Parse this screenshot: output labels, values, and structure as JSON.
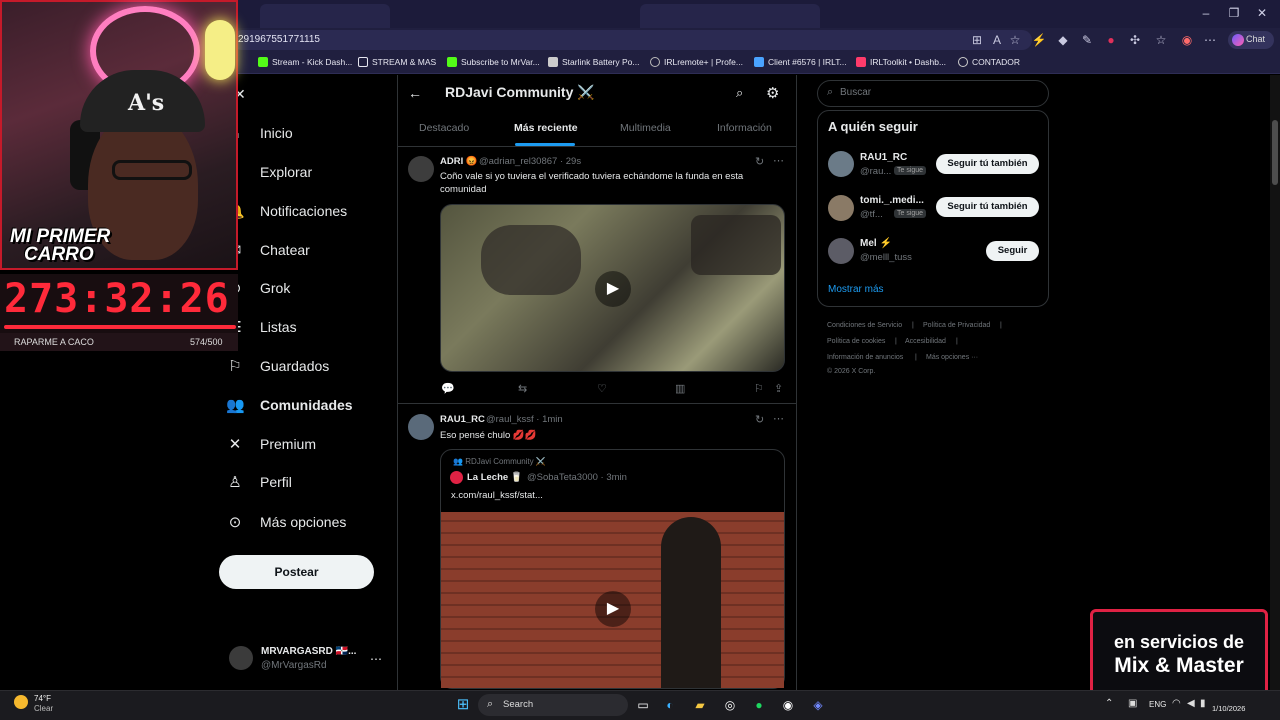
{
  "browser": {
    "url": "291967551771115",
    "chat_label": "Chat",
    "bookmarks": [
      {
        "label": "Stream - Kick Dash...",
        "color": "#53fc18"
      },
      {
        "label": "STREAM & MAS",
        "color": "#e6e6f0"
      },
      {
        "label": "Subscribe to MrVar...",
        "color": "#53fc18"
      },
      {
        "label": "Starlink Battery Po...",
        "color": "#cccccc"
      },
      {
        "label": "IRLremote+ | Profe...",
        "color": "#bbbbbb"
      },
      {
        "label": "Client #6576 | IRLT...",
        "color": "#4aa3ff"
      },
      {
        "label": "IRLToolkit • Dashb...",
        "color": "#ff3b6b"
      },
      {
        "label": "CONTADOR",
        "color": "#cccccc"
      }
    ]
  },
  "stream": {
    "title_line1": "MI PRIMER",
    "title_line2": "CARRO",
    "cap_logo": "A's",
    "timer": "273:32:26",
    "goal_label": "RAPARME A CACO",
    "goal_count": "574/500"
  },
  "sidebar": {
    "items": [
      {
        "label": "Inicio",
        "icon": "home-icon",
        "glyph": "⌂"
      },
      {
        "label": "Explorar",
        "icon": "search-icon",
        "glyph": "⌕"
      },
      {
        "label": "Notificaciones",
        "icon": "bell-icon",
        "glyph": "♫"
      },
      {
        "label": "Chatear",
        "icon": "chat-icon",
        "glyph": "✉"
      },
      {
        "label": "Grok",
        "icon": "grok-icon",
        "glyph": "⊘"
      },
      {
        "label": "Listas",
        "icon": "list-icon",
        "glyph": "☰"
      },
      {
        "label": "Guardados",
        "icon": "bookmark-icon",
        "glyph": "⚑"
      },
      {
        "label": "Comunidades",
        "icon": "communities-icon",
        "glyph": "👥"
      },
      {
        "label": "Premium",
        "icon": "x-icon",
        "glyph": "✕"
      },
      {
        "label": "Perfil",
        "icon": "person-icon",
        "glyph": "♙"
      },
      {
        "label": "Más opciones",
        "icon": "more-icon",
        "glyph": "⋯"
      }
    ],
    "post_label": "Postear",
    "account_name": "MRVARGASRD 🇩🇴...",
    "account_handle": "@MrVargasRd"
  },
  "timeline": {
    "community_title": "RDJavi Community ⚔️",
    "tabs": [
      "Destacado",
      "Más reciente",
      "Multimedia",
      "Información"
    ],
    "active_tab": "Más reciente",
    "posts": [
      {
        "name": "ADRI 😡",
        "handle": "@adrian_rel30867 · 29s",
        "text": "Coño vale si yo tuviera el verificado tuviera echándome la funda en esta comunidad"
      },
      {
        "name": "RAU1_RC",
        "handle": "@raul_kssf · 1min",
        "text": "Eso pensé chulo 💋💋",
        "quote": {
          "community": "RDJavi Community ⚔️",
          "name": "La Leche 🥛",
          "handle": "@SobaTeta3000 · 3min",
          "text": "x.com/raul_kssf/stat..."
        }
      }
    ]
  },
  "right": {
    "search_placeholder": "Buscar",
    "follow_title": "A quién seguir",
    "suggestions": [
      {
        "name": "RAU1_RC",
        "handle": "@rau...",
        "badge": "Te sigue",
        "button": "Seguir tú también"
      },
      {
        "name": "tomi._.medi...",
        "handle": "@tf...",
        "badge": "Te sigue",
        "button": "Seguir tú también"
      },
      {
        "name": "Mel ⚡",
        "handle": "@melll_tuss",
        "badge": "",
        "button": "Seguir"
      }
    ],
    "show_more": "Mostrar más",
    "legal": {
      "l1a": "Condiciones de Servicio",
      "l1b": "Política de Privacidad",
      "l2a": "Política de cookies",
      "l2b": "Accesibilidad",
      "l3a": "Información de anuncios",
      "l3b": "Más opciones ···",
      "l4": "© 2026 X Corp."
    }
  },
  "promo": {
    "line1": "en servicios de",
    "line2": "Mix & Master"
  },
  "taskbar": {
    "temp": "74°F",
    "weather": "Clear",
    "search_label": "Search",
    "lang": "ENG",
    "date": "1/10/2026"
  }
}
